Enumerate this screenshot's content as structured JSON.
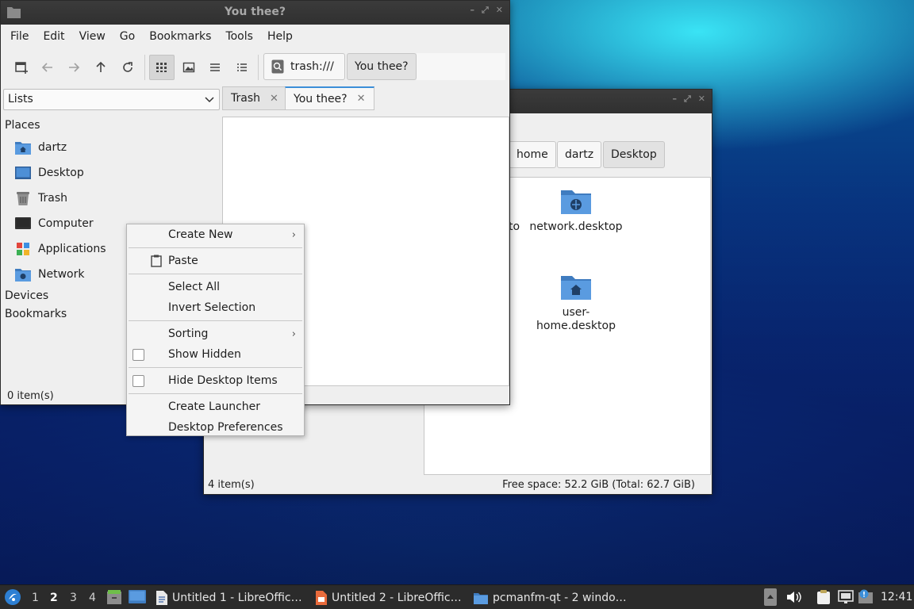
{
  "front_window": {
    "title": "You thee?",
    "menu": [
      "File",
      "Edit",
      "View",
      "Go",
      "Bookmarks",
      "Tools",
      "Help"
    ],
    "address": "trash:///",
    "crumb": "You thee?",
    "side_selector": "Lists",
    "tabs": [
      {
        "label": "Trash"
      },
      {
        "label": "You thee?"
      }
    ],
    "places_header": "Places",
    "places": [
      "dartz",
      "Desktop",
      "Trash",
      "Computer",
      "Applications",
      "Network"
    ],
    "devices_header": "Devices",
    "bookmarks_header": "Bookmarks",
    "status": "0 item(s)"
  },
  "back_window": {
    "crumbs": [
      "home",
      "dartz",
      "Desktop"
    ],
    "partial_label": "to",
    "icons": [
      {
        "label": "network.desktop"
      },
      {
        "label": "user-\nhome.desktop"
      }
    ],
    "status_left": "4 item(s)",
    "status_right": "Free space: 52.2 GiB (Total: 62.7 GiB)"
  },
  "context_menu": {
    "create_new": "Create New",
    "paste": "Paste",
    "select_all": "Select All",
    "invert_selection": "Invert Selection",
    "sorting": "Sorting",
    "show_hidden": "Show Hidden",
    "hide_desktop_items": "Hide Desktop Items",
    "create_launcher": "Create Launcher",
    "desktop_preferences": "Desktop Preferences"
  },
  "taskbar": {
    "desktops": [
      "1",
      "2",
      "3",
      "4"
    ],
    "active_desktop": "2",
    "tasks": [
      "Untitled 1 - LibreOffic…",
      "Untitled 2 - LibreOffic…",
      "pcmanfm-qt - 2 windo…"
    ],
    "clock": "12:41"
  },
  "colors": {
    "folder_blue": "#4d8fd6",
    "accent": "#3b8ed8",
    "taskbar_bg": "#2b2b2b"
  }
}
